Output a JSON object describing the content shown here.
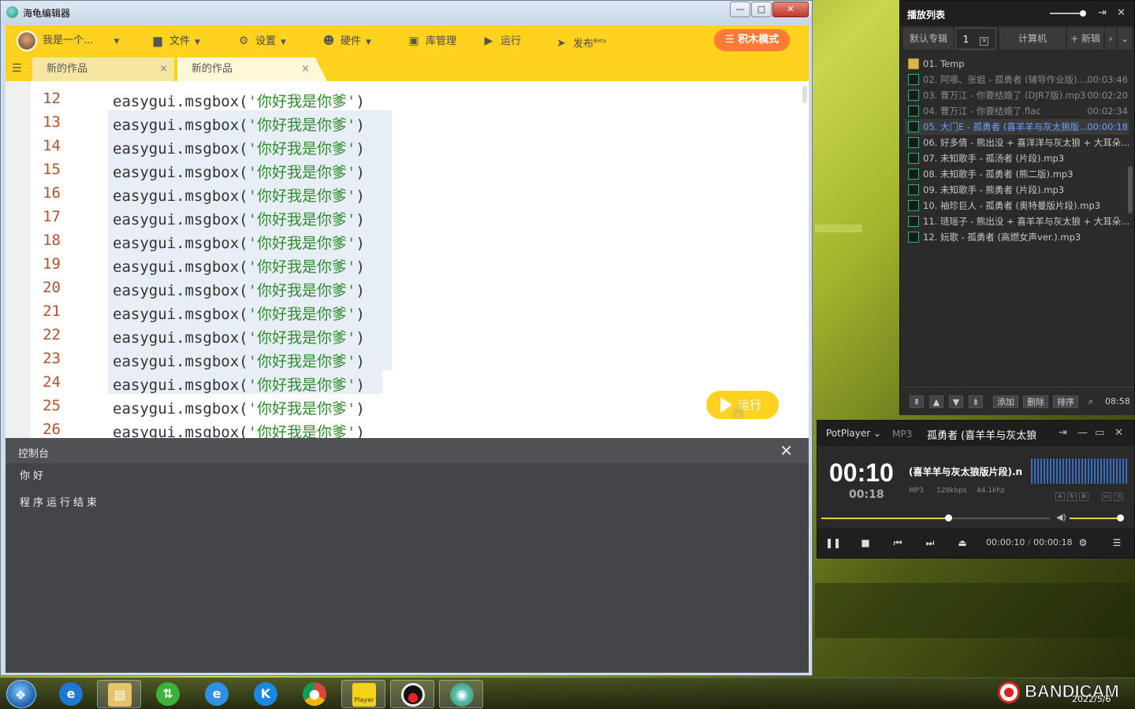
{
  "editor_window": {
    "title": "海龟编辑器",
    "controls": {
      "minimize": "—",
      "maximize": "□",
      "close": "✕"
    },
    "toolbar": {
      "user": "我是一个...",
      "file": "文件",
      "settings": "设置",
      "hardware": "硬件",
      "library": "库管理",
      "run": "运行",
      "publish": "发布",
      "publish_badge": "Beta",
      "block_mode": "积木模式"
    },
    "tabs": [
      {
        "label": "新的作品",
        "close": "×"
      },
      {
        "label": "新的作品",
        "close": "×"
      }
    ],
    "code_lines": [
      {
        "num": "12",
        "pre": "easygui.msgbox(",
        "str": "'你好我是你爹'",
        "post": ")"
      },
      {
        "num": "13",
        "pre": "easygui.msgbox(",
        "str": "'你好我是你爹'",
        "post": ")"
      },
      {
        "num": "14",
        "pre": "easygui.msgbox(",
        "str": "'你好我是你爹'",
        "post": ")"
      },
      {
        "num": "15",
        "pre": "easygui.msgbox(",
        "str": "'你好我是你爹'",
        "post": ")"
      },
      {
        "num": "16",
        "pre": "easygui.msgbox(",
        "str": "'你好我是你爹'",
        "post": ")"
      },
      {
        "num": "17",
        "pre": "easygui.msgbox(",
        "str": "'你好我是你爹'",
        "post": ")"
      },
      {
        "num": "18",
        "pre": "easygui.msgbox(",
        "str": "'你好我是你爹'",
        "post": ")"
      },
      {
        "num": "19",
        "pre": "easygui.msgbox(",
        "str": "'你好我是你爹'",
        "post": ")"
      },
      {
        "num": "20",
        "pre": "easygui.msgbox(",
        "str": "'你好我是你爹'",
        "post": ")"
      },
      {
        "num": "21",
        "pre": "easygui.msgbox(",
        "str": "'你好我是你爹'",
        "post": ")"
      },
      {
        "num": "22",
        "pre": "easygui.msgbox(",
        "str": "'你好我是你爹'",
        "post": ")"
      },
      {
        "num": "23",
        "pre": "easygui.msgbox(",
        "str": "'你好我是你爹'",
        "post": ")"
      },
      {
        "num": "24",
        "pre": "easygui.msgbox(",
        "str": "'你好我是你爹'",
        "post": ")"
      },
      {
        "num": "25",
        "pre": "easygui.msgbox(",
        "str": "'你好我是你爹'",
        "post": ")"
      },
      {
        "num": "26",
        "pre": "easygui.msgbox(",
        "str": "'你好我是你爹'",
        "post": ")"
      }
    ],
    "run_button": "运行",
    "console": {
      "title": "控制台",
      "close": "✕",
      "lines": [
        "你好",
        "程序运行结束"
      ]
    }
  },
  "playlist": {
    "title": "播放列表",
    "tabs": [
      "默认专辑",
      "1",
      "计算机",
      "+ 新辑"
    ],
    "items": [
      {
        "name": "01. Temp",
        "time": ""
      },
      {
        "name": "02. 阿哪、张姐 - 孤勇者 (辅导作业版)....",
        "time": "00:03:46"
      },
      {
        "name": "03. 曹万江 - 你要结婚了 (DJR7版).mp3",
        "time": "00:02:20"
      },
      {
        "name": "04. 曹万江 - 你要结婚了.flac",
        "time": "00:02:34"
      },
      {
        "name": "05. 大门E - 孤勇者 (喜羊羊与灰太狼版...",
        "time": "00:00:18"
      },
      {
        "name": "06. 好多倩 - 熊出没 + 喜洋洋与灰太狼 + 大耳朵...",
        "time": ""
      },
      {
        "name": "07. 未知歌手 - 孤汤者 (片段).mp3",
        "time": ""
      },
      {
        "name": "08. 未知歌手 - 孤勇者 (熊二版).mp3",
        "time": ""
      },
      {
        "name": "09. 未知歌手 - 熊勇者 (片段).mp3",
        "time": ""
      },
      {
        "name": "10. 袖珍巨人 - 孤勇者 (奥特曼版片段).mp3",
        "time": ""
      },
      {
        "name": "11. 琏瑶子 - 熊出没 + 喜羊羊与灰太狼 + 大耳朵...",
        "time": ""
      },
      {
        "name": "12. 妧歌 - 孤勇者 (高燃女声ver.).mp3",
        "time": ""
      }
    ],
    "footer": {
      "add": "添加",
      "delete": "删除",
      "sort": "排序",
      "total_time": "08:58"
    }
  },
  "potplayer": {
    "brand": "PotPlayer",
    "format": "MP3",
    "song": "孤勇者 (喜羊羊与灰太狼",
    "elapsed_big": "00:10",
    "duration_small": "00:18",
    "song_full": "(喜羊羊与灰太狼版片段).n",
    "codec": "MP3",
    "bitrate": "128kbps",
    "samplerate": "44.1khz",
    "time_current": "00:00:10",
    "time_sep": "/",
    "time_total": "00:00:18",
    "progress": 0.555,
    "volume": 0.95
  },
  "taskbar": {
    "player_label": "Player",
    "recorder": "BANDICAM",
    "date": "2022/5/6"
  }
}
